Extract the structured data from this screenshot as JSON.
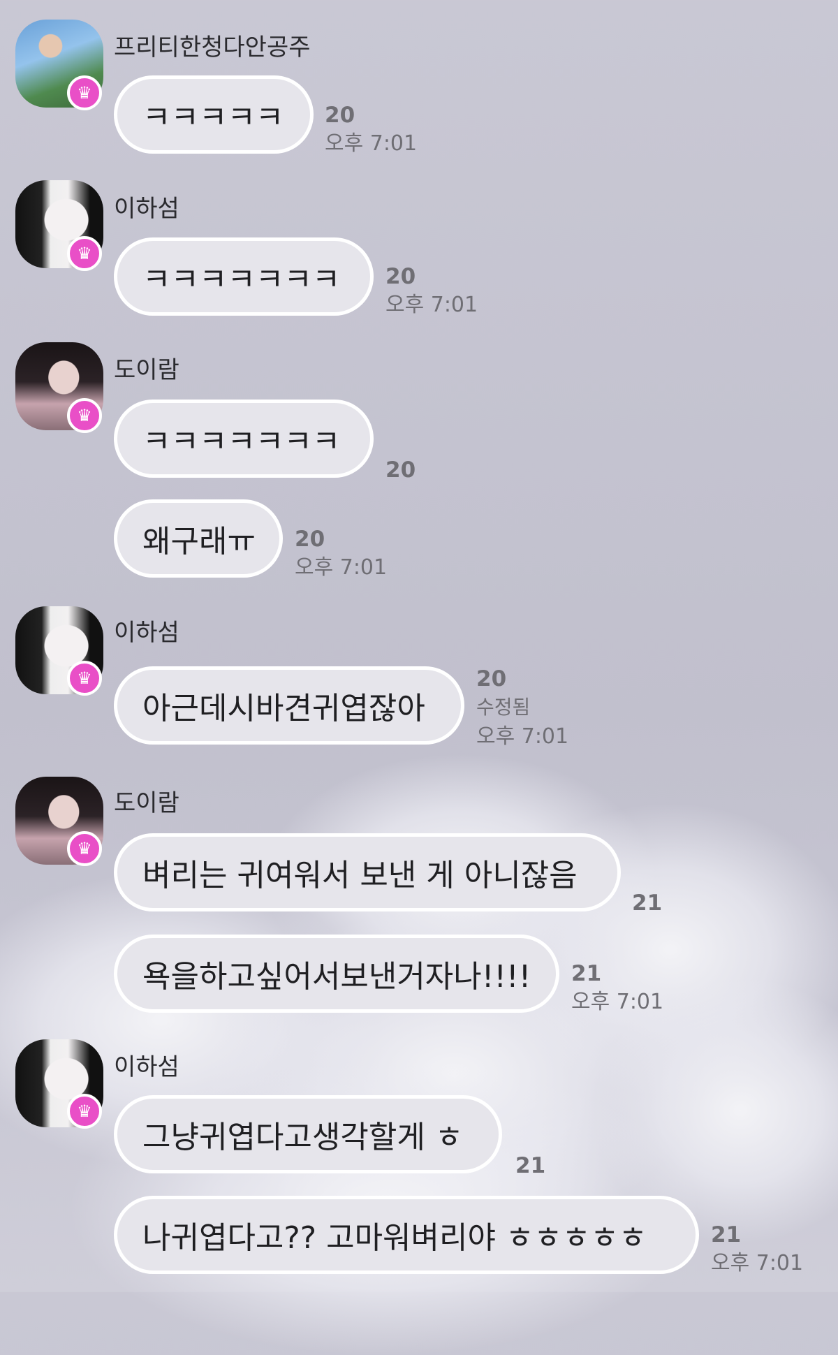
{
  "messages": [
    {
      "sender": "프리티한청다안공주",
      "text": "ㅋㅋㅋㅋㅋ",
      "count": "20",
      "time": "오후 7:01"
    },
    {
      "sender": "이하섬",
      "text": "ㅋㅋㅋㅋㅋㅋㅋ",
      "count": "20",
      "time": "오후 7:01"
    },
    {
      "sender": "도이람",
      "text": "ㅋㅋㅋㅋㅋㅋㅋ",
      "count": "20"
    },
    {
      "text": "왜구래ㅠ",
      "count": "20",
      "time": "오후 7:01"
    },
    {
      "sender": "이하섬",
      "text": "아근데시바견귀엽잖아",
      "count": "20",
      "edited": "수정됨",
      "time": "오후 7:01"
    },
    {
      "sender": "도이람",
      "text": "벼리는 귀여워서 보낸 게 아니잖음",
      "count": "21"
    },
    {
      "text": "욕을하고싶어서보낸거자나!!!!",
      "count": "21",
      "time": "오후 7:01"
    },
    {
      "sender": "이하섬",
      "text": "그냥귀엽다고생각할게 ㅎ",
      "count": "21"
    },
    {
      "text": "나귀엽다고?? 고마워벼리야 ㅎㅎㅎㅎㅎ",
      "count": "21",
      "time": "오후 7:01"
    }
  ],
  "icons": {
    "badge": "crown-icon"
  },
  "colors": {
    "badge": "#e94fc7",
    "bubble": "#e6e5eb",
    "bubble_border": "#ffffff",
    "meta": "#6f6e74"
  }
}
